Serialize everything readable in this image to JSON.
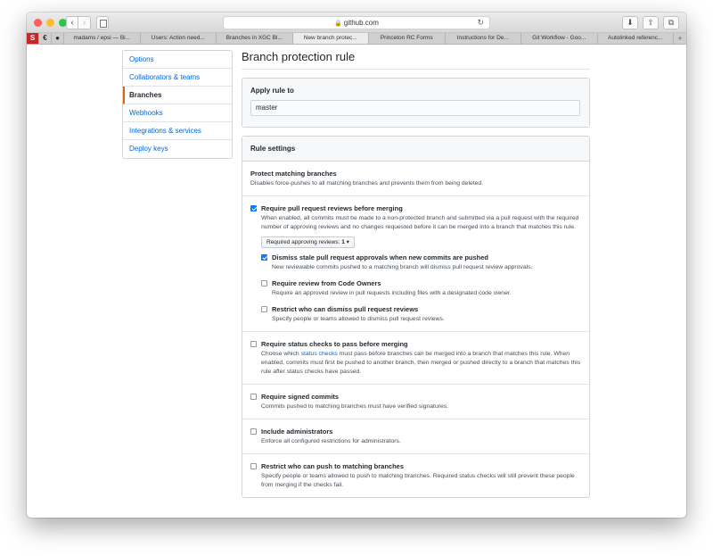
{
  "browser": {
    "url": "github.com",
    "tabs": [
      {
        "label": "madams / epsi — Bi..."
      },
      {
        "label": "Users: Action need..."
      },
      {
        "label": "Branches in XGC Bl..."
      },
      {
        "label": "New branch protec..."
      },
      {
        "label": "Princeton RC Forms"
      },
      {
        "label": "Instructions for De..."
      },
      {
        "label": "Git Workflow - Goo..."
      },
      {
        "label": "Autolinked referenc..."
      }
    ],
    "pinned": [
      "S",
      "€",
      "●"
    ],
    "new_tab": "+",
    "colors": {
      "close": "#fc5f57",
      "minimize": "#fdbc2e",
      "maximize": "#28c840"
    }
  },
  "sidebar": {
    "items": [
      {
        "label": "Options"
      },
      {
        "label": "Collaborators & teams"
      },
      {
        "label": "Branches"
      },
      {
        "label": "Webhooks"
      },
      {
        "label": "Integrations & services"
      },
      {
        "label": "Deploy keys"
      }
    ]
  },
  "page": {
    "title": "Branch protection rule",
    "apply_rule_label": "Apply rule to",
    "apply_rule_value": "master",
    "rule_settings_label": "Rule settings",
    "protect": {
      "title": "Protect matching branches",
      "desc": "Disables force-pushes to all matching branches and prevents them from being deleted."
    },
    "reviews": {
      "title": "Require pull request reviews before merging",
      "desc": "When enabled, all commits must be made to a non-protected branch and submitted via a pull request with the required number of approving reviews and no changes requested before it can be merged into a branch that matches this rule.",
      "select_label": "Required approving reviews:",
      "select_value": "1",
      "checked": true,
      "sub_options": [
        {
          "title": "Dismiss stale pull request approvals when new commits are pushed",
          "desc": "New reviewable commits pushed to a matching branch will dismiss pull request review approvals.",
          "checked": true
        },
        {
          "title": "Require review from Code Owners",
          "desc": "Require an approved review in pull requests including files with a designated code owner.",
          "checked": false
        },
        {
          "title": "Restrict who can dismiss pull request reviews",
          "desc": "Specify people or teams allowed to dismiss pull request reviews.",
          "checked": false
        }
      ]
    },
    "status_checks": {
      "title": "Require status checks to pass before merging",
      "desc_before": "Choose which ",
      "desc_link": "status checks",
      "desc_after": " must pass before branches can be merged into a branch that matches this rule. When enabled, commits must first be pushed to another branch, then merged or pushed directly to a branch that matches this rule after status checks have passed.",
      "checked": false
    },
    "signed": {
      "title": "Require signed commits",
      "desc": "Commits pushed to matching branches must have verified signatures.",
      "checked": false
    },
    "admins": {
      "title": "Include administrators",
      "desc": "Enforce all configured restrictions for administrators.",
      "checked": false
    },
    "restrict_push": {
      "title": "Restrict who can push to matching branches",
      "desc": "Specify people or teams allowed to push to matching branches. Required status checks will still prevent these people from merging if the checks fail.",
      "checked": false
    }
  }
}
